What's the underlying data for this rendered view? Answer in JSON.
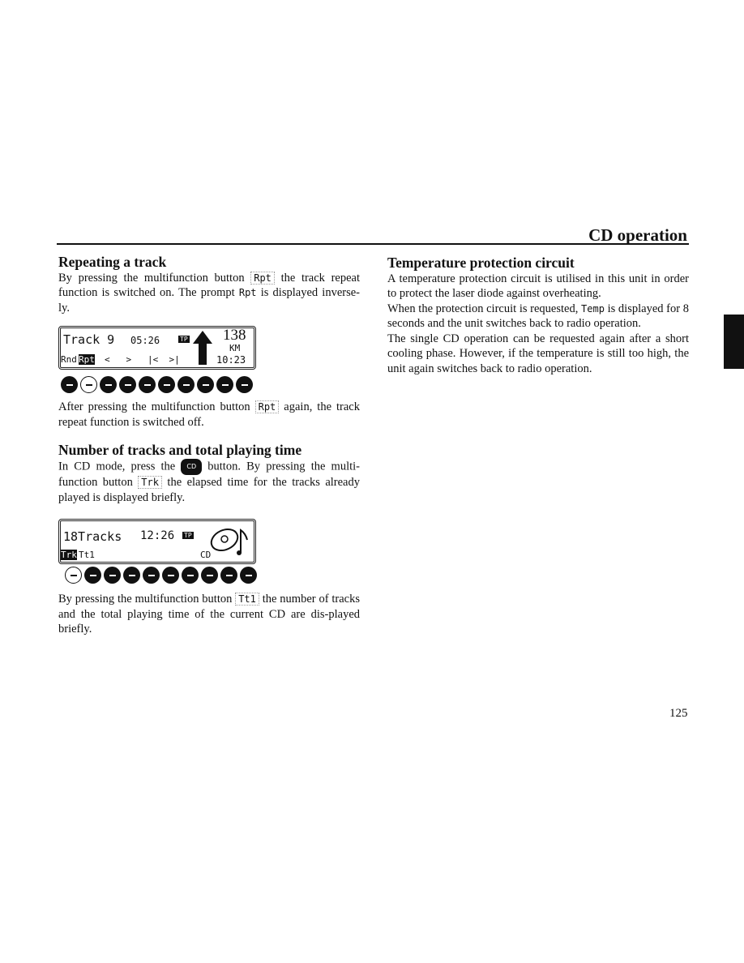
{
  "header": {
    "section_title": "CD operation"
  },
  "left": {
    "repeat": {
      "title": "Repeating a track",
      "p1_a": "By pressing the multifunction button ",
      "p1_btn": "Rpt",
      "p1_b": " the track repeat function is switched on. The prompt ",
      "p1_prompt": "Rpt",
      "p1_c": " is displayed inverse-ly.",
      "display": {
        "line1_track": "Track  9",
        "line1_time": "05:26",
        "tp": "TP",
        "freq": "138",
        "unit": "KM",
        "clock": "10:23",
        "rnd": "Rnd",
        "rpt": "Rpt",
        "nav": "<   >   |<  >|"
      },
      "p2_a": "After pressing the multifunction button ",
      "p2_btn": "Rpt",
      "p2_b": " again, the track repeat function is switched off."
    },
    "tracks": {
      "title": "Number of tracks and total playing time",
      "p1_a": "In CD mode, press the ",
      "p1_cd": "CD",
      "p1_b": " button. By pressing the multi-function button ",
      "p1_btn": "Trk",
      "p1_c": " the elapsed time for the tracks already played is displayed briefly.",
      "display": {
        "line1": "18Tracks",
        "time": "12:26",
        "tp": "TP",
        "trk": "Trk",
        "ttl": "Tt1",
        "cd": "CD"
      },
      "p2_a": "By pressing the multifunction button ",
      "p2_btn": "Tt1",
      "p2_b": " the number of tracks and the total playing time of the current CD are dis-played briefly."
    }
  },
  "right": {
    "temp": {
      "title": "Temperature protection circuit",
      "p1": "A temperature protection circuit is utilised in this unit in order to protect the laser diode against overheating.",
      "p2_a": "When the protection circuit is requested, ",
      "p2_temp": "Temp",
      "p2_b": " is displayed for 8 seconds and the unit switches back to radio operation.",
      "p3": "The single CD operation can be requested again after a short cooling phase. However, if the temperature is still too high, the unit again switches back to radio operation."
    }
  },
  "footer": {
    "page_number": "125"
  }
}
